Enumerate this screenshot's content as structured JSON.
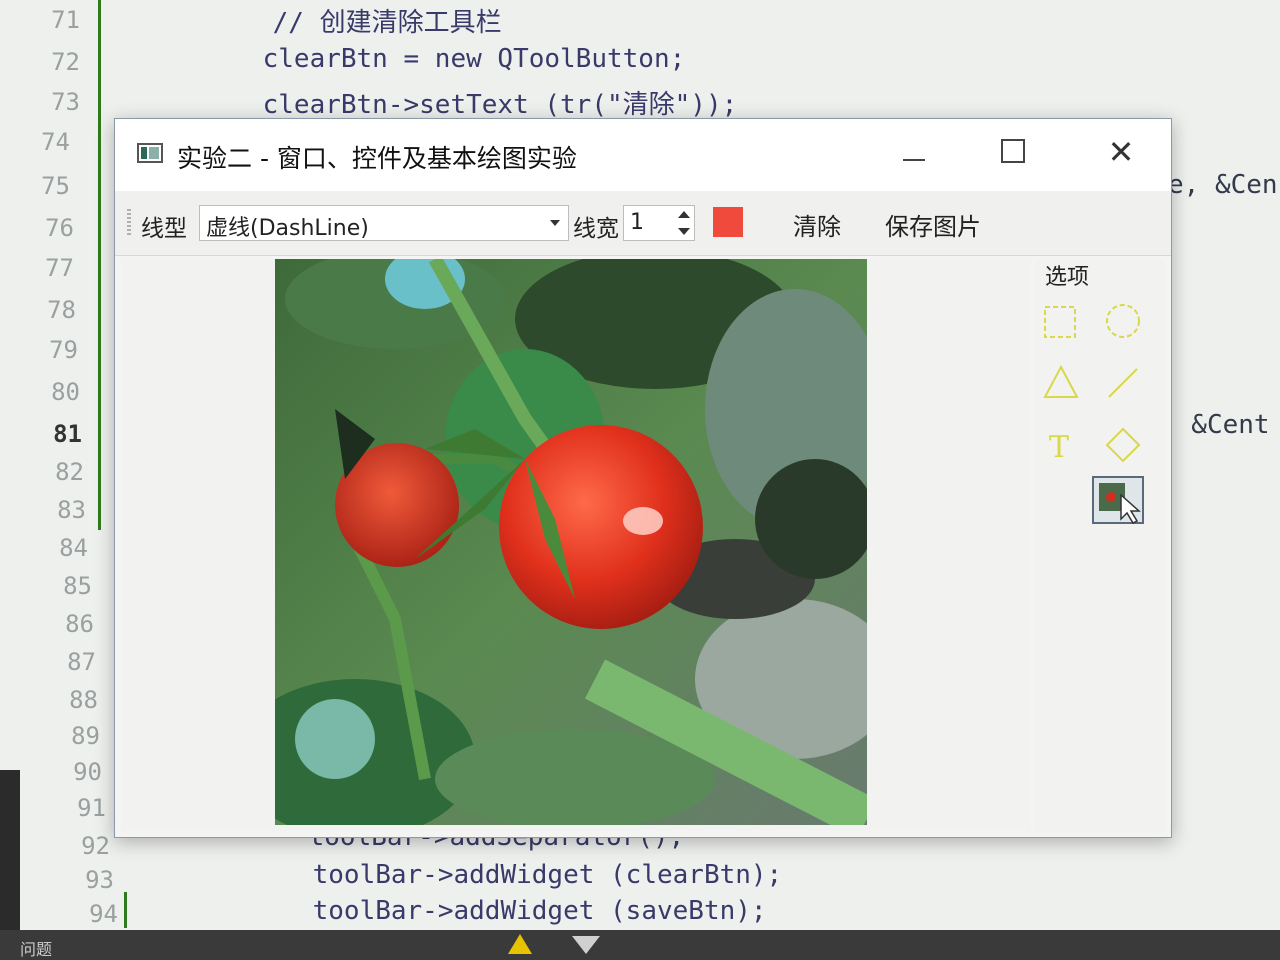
{
  "editor": {
    "rows": [
      {
        "line": "71",
        "code": "    // 创建清除工具栏"
      },
      {
        "line": "72",
        "code": "    clearBtn = new QToolButton;"
      },
      {
        "line": "73",
        "code": "    clearBtn->setText (tr(\"清除\"));"
      },
      {
        "line": "74",
        "code": ""
      },
      {
        "line": "75",
        "code": ""
      },
      {
        "line": "76",
        "code": ""
      },
      {
        "line": "77",
        "code": ""
      },
      {
        "line": "78",
        "code": ""
      },
      {
        "line": "79",
        "code": ""
      },
      {
        "line": "80",
        "code": ""
      },
      {
        "line": "81",
        "code": ""
      },
      {
        "line": "82",
        "code": ""
      },
      {
        "line": "83",
        "code": ""
      },
      {
        "line": "84",
        "code": ""
      },
      {
        "line": "85",
        "code": ""
      },
      {
        "line": "86",
        "code": ""
      },
      {
        "line": "87",
        "code": ""
      },
      {
        "line": "88",
        "code": ""
      },
      {
        "line": "89",
        "code": ""
      },
      {
        "line": "90",
        "code": ""
      },
      {
        "line": "91",
        "code": ""
      },
      {
        "line": "92",
        "code": "    toolBar->addSeparator();"
      },
      {
        "line": "93",
        "code": "    toolBar->addWidget (clearBtn);"
      },
      {
        "line": "94",
        "code": "    toolBar->addWidget (saveBtn);"
      }
    ],
    "current_line": "81",
    "fragment_75": "e, &Cen",
    "fragment_81": ", &Cent"
  },
  "statusbar": {
    "text": "问题"
  },
  "window": {
    "title": "实验二 - 窗口、控件及基本绘图实验",
    "minimize": "",
    "maximize": "",
    "close": "✕"
  },
  "toolbar": {
    "linetype_label": "线型",
    "linetype_value": "虚线(DashLine)",
    "width_label": "线宽",
    "width_value": "1",
    "color_value": "#f04a3c",
    "clear_label": "清除",
    "save_label": "保存图片"
  },
  "dock": {
    "title": "选项",
    "tool_color": "#d8d84a",
    "tools": [
      "rectangle-icon",
      "ellipse-icon",
      "triangle-icon",
      "line-icon",
      "text-icon",
      "diamond-icon",
      "image-icon"
    ],
    "text_tool_glyph": "T"
  },
  "canvas": {
    "image": "cherry tomato photo"
  }
}
